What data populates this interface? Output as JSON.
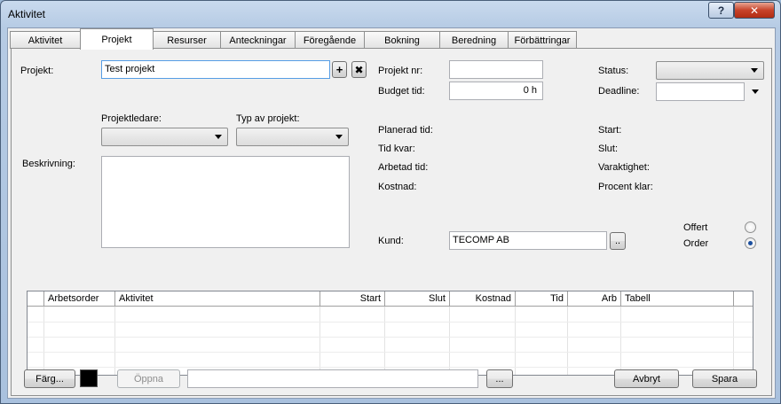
{
  "window": {
    "title": "Aktivitet",
    "help_label": "?",
    "close_label": "✕"
  },
  "tabs": [
    "Aktivitet",
    "Projekt",
    "Resurser",
    "Anteckningar",
    "Föregående",
    "Bokning",
    "Beredning",
    "Förbättringar"
  ],
  "active_tab": "Projekt",
  "project": {
    "label": "Projekt:",
    "value": "Test projekt",
    "add_label": "+",
    "remove_label": "✖",
    "leader_label": "Projektledare:",
    "leader_value": "",
    "type_label": "Typ av projekt:",
    "type_value": "",
    "description_label": "Beskrivning:",
    "description_value": ""
  },
  "details": {
    "number_label": "Projekt nr:",
    "number_value": "",
    "budget_label": "Budget tid:",
    "budget_value": "0 h",
    "planned_label": "Planerad tid:",
    "remaining_label": "Tid kvar:",
    "worked_label": "Arbetad tid:",
    "cost_label": "Kostnad:"
  },
  "status": {
    "status_label": "Status:",
    "status_value": "",
    "deadline_label": "Deadline:",
    "deadline_value": "",
    "start_label": "Start:",
    "end_label": "Slut:",
    "duration_label": "Varaktighet:",
    "percent_label": "Procent klar:"
  },
  "customer": {
    "label": "Kund:",
    "value": "TECOMP AB",
    "browse_label": ".."
  },
  "offer": {
    "offert_label": "Offert",
    "order_label": "Order",
    "selected": "Order"
  },
  "grid": {
    "columns": [
      "",
      "Arbetsorder",
      "Aktivitet",
      "Start",
      "Slut",
      "Kostnad",
      "Tid",
      "Arb",
      "Tabell",
      ""
    ]
  },
  "footer": {
    "color_label": "Färg...",
    "color_value": "#000000",
    "open_label": "Öppna",
    "path_value": "",
    "browse_label": "...",
    "cancel_label": "Avbryt",
    "save_label": "Spara"
  }
}
